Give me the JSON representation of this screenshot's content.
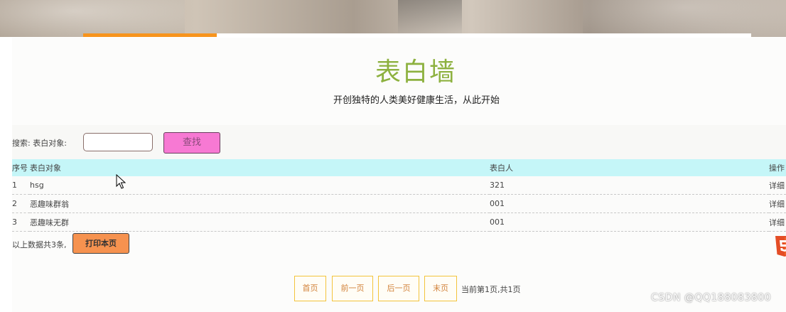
{
  "header": {
    "title": "表白墙",
    "subtitle": "开创独特的人类美好健康生活，从此开始"
  },
  "search": {
    "label": "搜索: 表白对象:",
    "value": "",
    "placeholder": "",
    "button_label": "查找"
  },
  "table": {
    "columns": [
      "序号",
      "表白对象",
      "表白人",
      "操作"
    ],
    "rows": [
      {
        "index": "1",
        "target": "hsg",
        "sender": "321",
        "action": "详细"
      },
      {
        "index": "2",
        "target": "恶趣味群翁",
        "sender": "001",
        "action": "详细"
      },
      {
        "index": "3",
        "target": "恶趣味无群",
        "sender": "001",
        "action": "详细"
      }
    ]
  },
  "footer": {
    "summary": "以上数据共3条,",
    "print_label": "打印本页"
  },
  "pagination": {
    "first": "首页",
    "prev": "前一页",
    "next": "后一页",
    "last": "末页",
    "info": "当前第1页,共1页"
  },
  "watermark": "CSDN @QQ188083800",
  "colors": {
    "title": "#8db13f",
    "search_button": "#f779d3",
    "print_button": "#f6924f",
    "table_header": "#c5f6f8",
    "tab_active": "#f7941d",
    "pager_border": "#f3c43c"
  },
  "icons": [
    "html5-icon",
    "cursor-icon"
  ]
}
